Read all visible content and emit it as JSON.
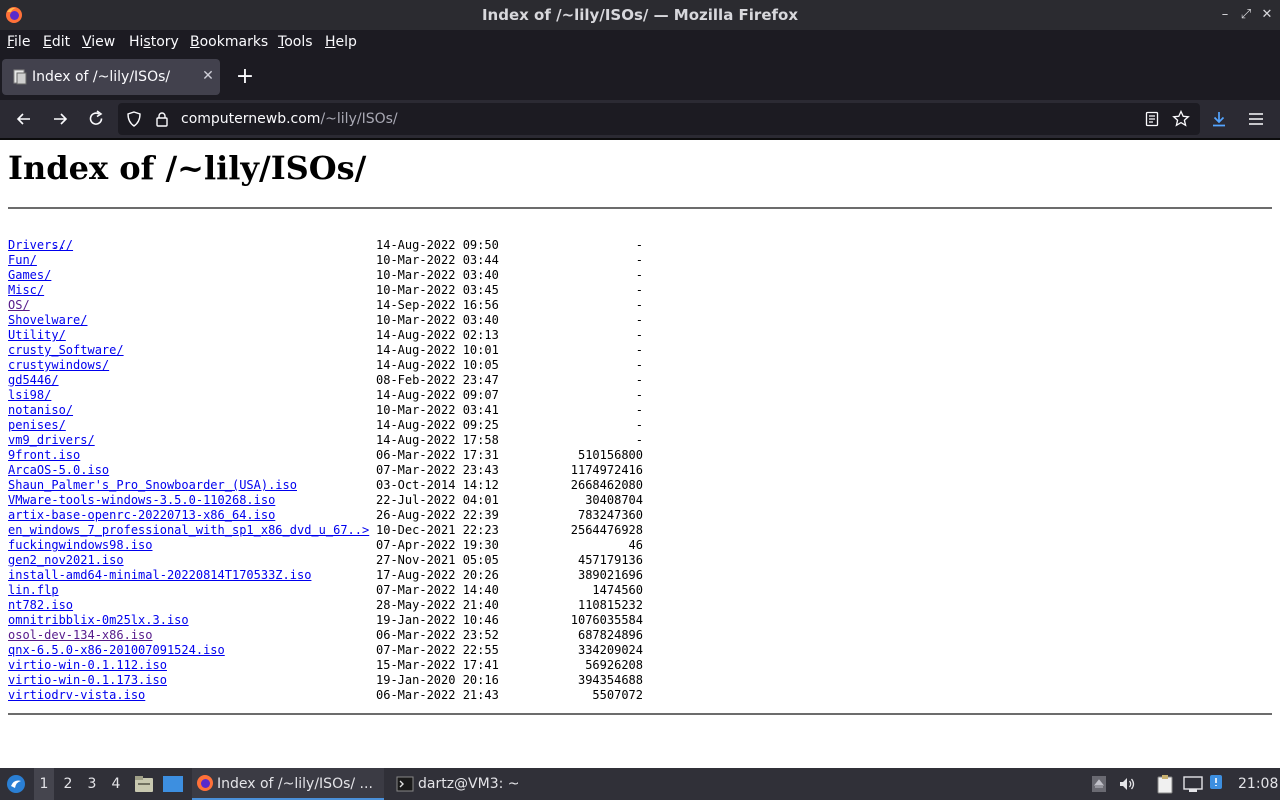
{
  "window": {
    "title": "Index of /~lily/ISOs/ — Mozilla Firefox"
  },
  "menu": {
    "items": [
      {
        "ul": "F",
        "rest": "ile"
      },
      {
        "ul": "E",
        "rest": "dit"
      },
      {
        "ul": "V",
        "rest": "iew"
      },
      {
        "ul": "",
        "pre": "Hi",
        "ul2": "s",
        "rest": "tory"
      },
      {
        "ul": "B",
        "rest": "ookmarks"
      },
      {
        "ul": "T",
        "rest": "ools"
      },
      {
        "ul": "H",
        "rest": "elp"
      }
    ]
  },
  "tab": {
    "title": "Index of /~lily/ISOs/"
  },
  "urlbar": {
    "domain": "computernewb.com",
    "path": "/~lily/ISOs/"
  },
  "page": {
    "heading": "Index of /~lily/ISOs/",
    "parent_link": "../",
    "entries": [
      {
        "name": "Drivers/",
        "date": "14-Aug-2022 09:50",
        "size": "-"
      },
      {
        "name": "Fun/",
        "date": "10-Mar-2022 03:44",
        "size": "-"
      },
      {
        "name": "Games/",
        "date": "10-Mar-2022 03:40",
        "size": "-"
      },
      {
        "name": "Misc/",
        "date": "10-Mar-2022 03:45",
        "size": "-"
      },
      {
        "name": "OS/",
        "date": "14-Sep-2022 16:56",
        "size": "-",
        "visited": true
      },
      {
        "name": "Shovelware/",
        "date": "10-Mar-2022 03:40",
        "size": "-"
      },
      {
        "name": "Utility/",
        "date": "14-Aug-2022 02:13",
        "size": "-"
      },
      {
        "name": "crusty_Software/",
        "date": "14-Aug-2022 10:01",
        "size": "-"
      },
      {
        "name": "crustywindows/",
        "date": "14-Aug-2022 10:05",
        "size": "-"
      },
      {
        "name": "gd5446/",
        "date": "08-Feb-2022 23:47",
        "size": "-"
      },
      {
        "name": "lsi98/",
        "date": "14-Aug-2022 09:07",
        "size": "-"
      },
      {
        "name": "notaniso/",
        "date": "10-Mar-2022 03:41",
        "size": "-"
      },
      {
        "name": "penises/",
        "date": "14-Aug-2022 09:25",
        "size": "-"
      },
      {
        "name": "vm9_drivers/",
        "date": "14-Aug-2022 17:58",
        "size": "-"
      },
      {
        "name": "9front.iso",
        "date": "06-Mar-2022 17:31",
        "size": "510156800"
      },
      {
        "name": "ArcaOS-5.0.iso",
        "date": "07-Mar-2022 23:43",
        "size": "1174972416"
      },
      {
        "name": "Shaun_Palmer's_Pro_Snowboarder_(USA).iso",
        "date": "03-Oct-2014 14:12",
        "size": "2668462080"
      },
      {
        "name": "VMware-tools-windows-3.5.0-110268.iso",
        "date": "22-Jul-2022 04:01",
        "size": "30408704"
      },
      {
        "name": "artix-base-openrc-20220713-x86_64.iso",
        "date": "26-Aug-2022 22:39",
        "size": "783247360"
      },
      {
        "name": "en_windows_7_professional_with_sp1_x86_dvd_u_67..>",
        "date": "10-Dec-2021 22:23",
        "size": "2564476928"
      },
      {
        "name": "fuckingwindows98.iso",
        "date": "07-Apr-2022 19:30",
        "size": "46"
      },
      {
        "name": "gen2_nov2021.iso",
        "date": "27-Nov-2021 05:05",
        "size": "457179136"
      },
      {
        "name": "install-amd64-minimal-20220814T170533Z.iso",
        "date": "17-Aug-2022 20:26",
        "size": "389021696"
      },
      {
        "name": "lin.flp",
        "date": "07-Mar-2022 14:40",
        "size": "1474560"
      },
      {
        "name": "nt782.iso",
        "date": "28-May-2022 21:40",
        "size": "110815232"
      },
      {
        "name": "omnitribblix-0m25lx.3.iso",
        "date": "19-Jan-2022 10:46",
        "size": "1076035584"
      },
      {
        "name": "osol-dev-134-x86.iso",
        "date": "06-Mar-2022 23:52",
        "size": "687824896",
        "visited": true
      },
      {
        "name": "qnx-6.5.0-x86-201007091524.iso",
        "date": "07-Mar-2022 22:55",
        "size": "334209024"
      },
      {
        "name": "virtio-win-0.1.112.iso",
        "date": "15-Mar-2022 17:41",
        "size": "56926208"
      },
      {
        "name": "virtio-win-0.1.173.iso",
        "date": "19-Jan-2020 20:16",
        "size": "394354688"
      },
      {
        "name": "virtiodrv-vista.iso",
        "date": "06-Mar-2022 21:43",
        "size": "5507072"
      }
    ]
  },
  "taskbar": {
    "workspaces": [
      "1",
      "2",
      "3",
      "4"
    ],
    "firefox_task": "Index of /~lily/ISOs/ ...",
    "terminal_task": "dartz@VM3: ~",
    "clock": "21:08"
  },
  "colors": {
    "link": "#0000ee",
    "visited_link": "#551a8b",
    "download_accent": "#54a4ff"
  }
}
